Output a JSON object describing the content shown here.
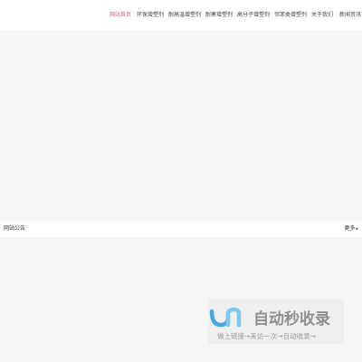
{
  "nav": {
    "items": [
      {
        "label": "网站首页",
        "active": true
      },
      {
        "label": "环保增塑剂",
        "active": false
      },
      {
        "label": "耐高温增塑剂",
        "active": false
      },
      {
        "label": "耐寒增塑剂",
        "active": false
      },
      {
        "label": "高分子增塑剂",
        "active": false
      },
      {
        "label": "邻苯类增塑剂",
        "active": false
      },
      {
        "label": "关于我们",
        "active": false
      },
      {
        "label": "新闻资讯",
        "active": false
      }
    ]
  },
  "notice": {
    "title": "网站公告",
    "more_label": "更多"
  },
  "watermark": {
    "title": "自动秒收录",
    "subtitle": "做上链接→来访一次→自动收录→"
  },
  "colors": {
    "accent": "#e05a7c",
    "watermark_blue": "#4aa8e0",
    "watermark_gray": "#9a9a9a"
  }
}
